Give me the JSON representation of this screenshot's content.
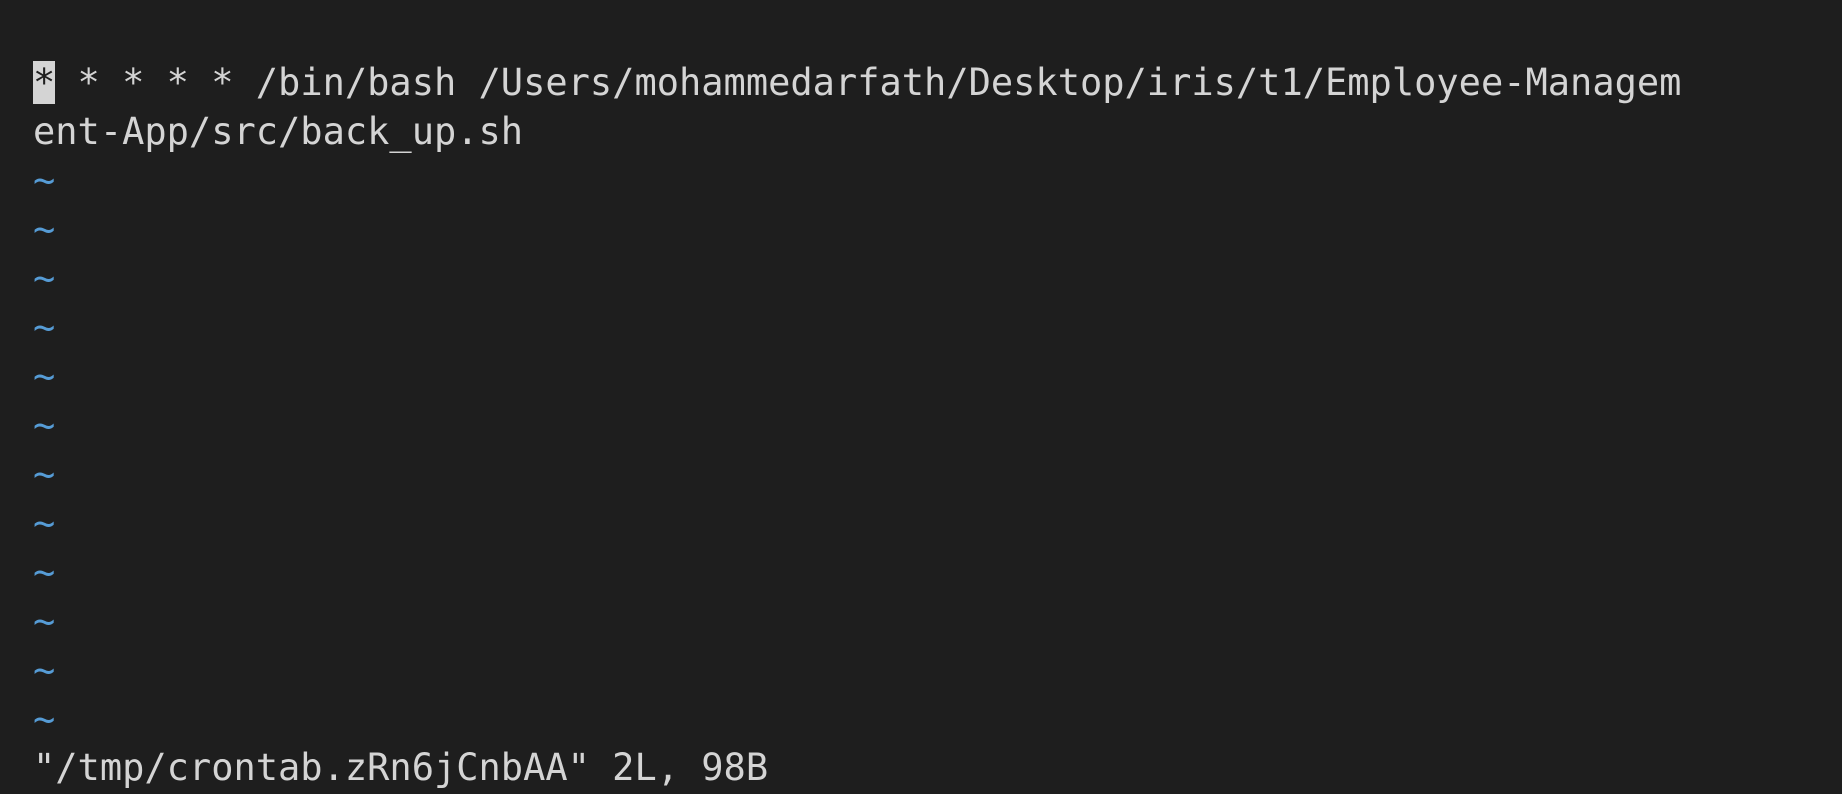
{
  "editor": {
    "cursor_char": "*",
    "line1_rest": " * * * * /bin/bash /Users/mohammedarfath/Desktop/iris/t1/Employee-Managem",
    "line2": "ent-App/src/back_up.sh",
    "empty_line_marker": "~"
  },
  "status": {
    "message": "\"/tmp/crontab.zRn6jCnbAA\" 2L, 98B"
  },
  "colors": {
    "background": "#1e1e1e",
    "text": "#d4d4d4",
    "tilde": "#569cd6"
  }
}
